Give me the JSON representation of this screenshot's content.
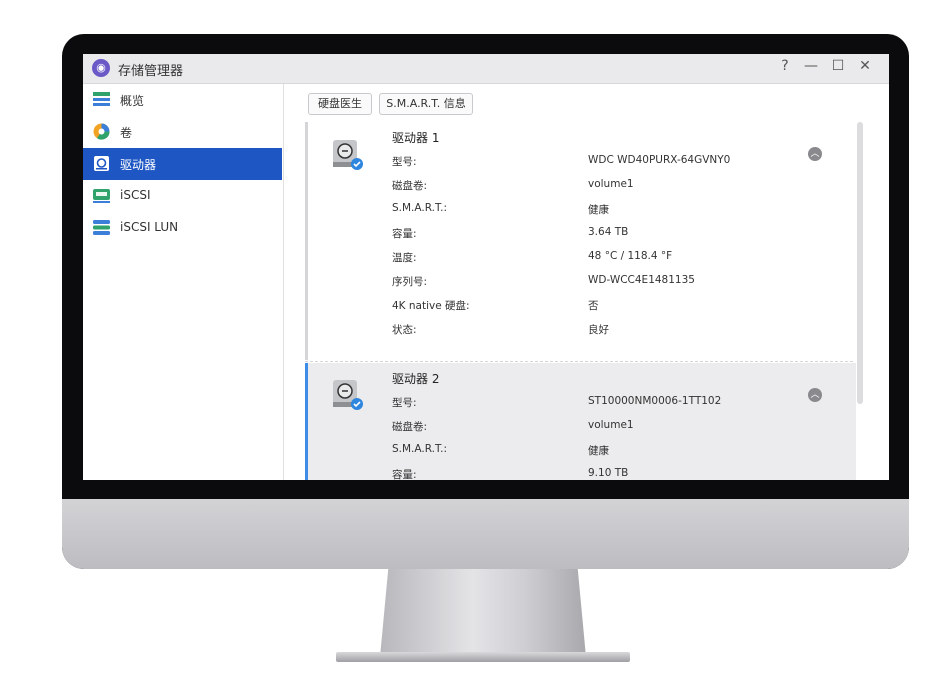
{
  "app": {
    "title": "存储管理器"
  },
  "window_controls": {
    "help": "?",
    "minimize": "—",
    "maximize": "☐",
    "close": "✕"
  },
  "sidebar": {
    "items": [
      {
        "label": "概览",
        "icon": "overview-icon",
        "active": false
      },
      {
        "label": "卷",
        "icon": "volume-pie-icon",
        "active": false
      },
      {
        "label": "驱动器",
        "icon": "drive-icon",
        "active": true
      },
      {
        "label": "iSCSI",
        "icon": "iscsi-icon",
        "active": false
      },
      {
        "label": "iSCSI LUN",
        "icon": "iscsi-lun-icon",
        "active": false
      }
    ]
  },
  "toolbar": {
    "disk_doctor": "硬盘医生",
    "smart_info": "S.M.A.R.T. 信息"
  },
  "drives": [
    {
      "title": "驱动器 1",
      "rows": [
        {
          "key": "型号:",
          "value": "WDC WD40PURX-64GVNY0"
        },
        {
          "key": "磁盘卷:",
          "value": "volume1"
        },
        {
          "key": "S.M.A.R.T.:",
          "value": "健康"
        },
        {
          "key": "容量:",
          "value": "3.64 TB"
        },
        {
          "key": "温度:",
          "value": "48 °C / 118.4 °F"
        },
        {
          "key": "序列号:",
          "value": "WD-WCC4E1481135"
        },
        {
          "key": "4K native 硬盘:",
          "value": "否"
        },
        {
          "key": "状态:",
          "value": "良好"
        }
      ]
    },
    {
      "title": "驱动器 2",
      "rows": [
        {
          "key": "型号:",
          "value": "ST10000NM0006-1TT102"
        },
        {
          "key": "磁盘卷:",
          "value": "volume1"
        },
        {
          "key": "S.M.A.R.T.:",
          "value": "健康"
        },
        {
          "key": "容量:",
          "value": "9.10 TB"
        }
      ]
    }
  ],
  "colors": {
    "accent": "#1e57c4",
    "selected_border": "#3d8ce8",
    "app_icon": "#6a59c7"
  }
}
